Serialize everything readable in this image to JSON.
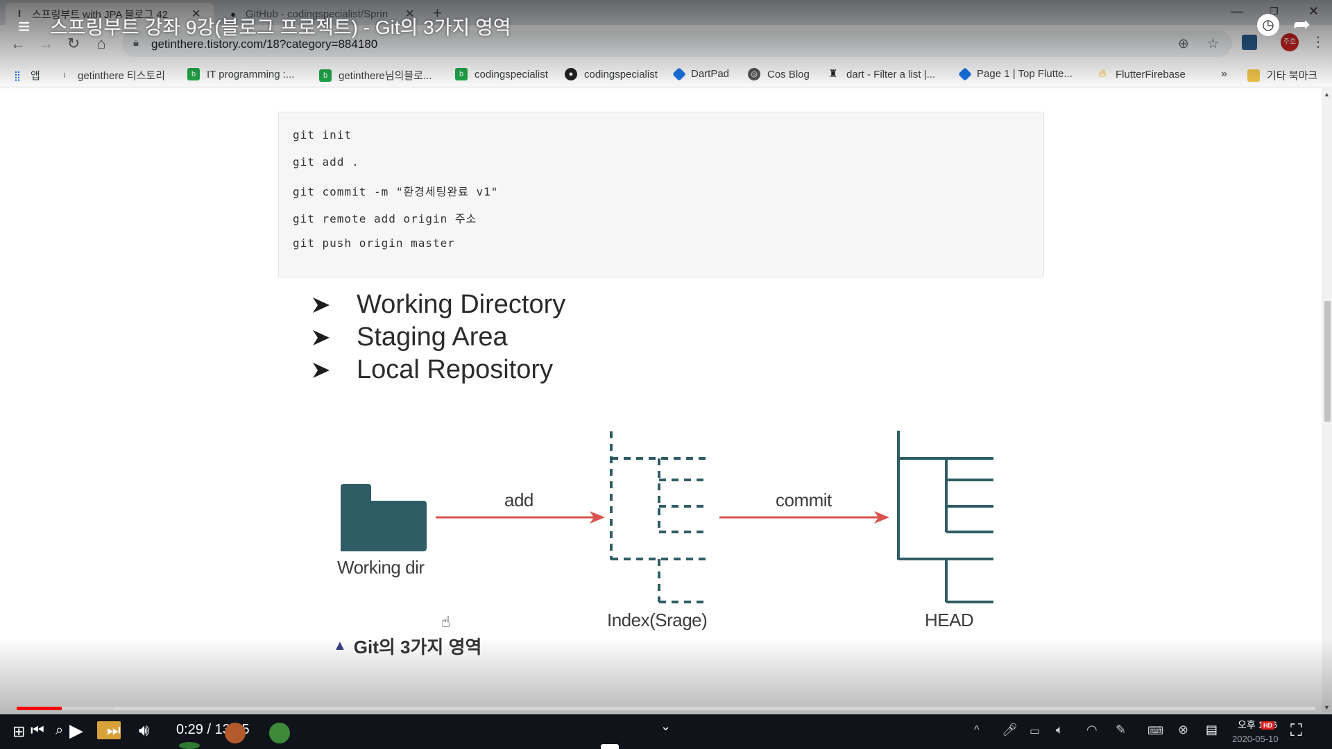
{
  "browser": {
    "tabs": [
      {
        "title": "스프링부트 with JPA 블로그 42",
        "favicon": "tistory-icon",
        "active": true
      },
      {
        "title": "GitHub - codingspecialist/Sprin",
        "favicon": "github-icon",
        "active": false
      }
    ],
    "url": "getinthere.tistory.com/18?category=884180",
    "profile_label": "주호"
  },
  "bookmarks": {
    "apps_label": "앱",
    "items": [
      {
        "label": "getinthere 티스토리",
        "icon": "tistory-icon",
        "color": "#222222"
      },
      {
        "label": "IT programming :...",
        "icon": "blog-icon",
        "color": "#21a84a"
      },
      {
        "label": "getinthere님의블로...",
        "icon": "blog-icon",
        "color": "#21a84a"
      },
      {
        "label": "codingspecialist",
        "icon": "blog-icon",
        "color": "#21a84a"
      },
      {
        "label": "codingspecialist",
        "icon": "github-icon",
        "color": "#222222"
      },
      {
        "label": "DartPad",
        "icon": "dart-icon",
        "color": "#1a73e8"
      },
      {
        "label": "Cos Blog",
        "icon": "globe-icon",
        "color": "#555555"
      },
      {
        "label": "dart - Filter a list |...",
        "icon": "stackoverflow-icon",
        "color": "#222222"
      },
      {
        "label": "Page 1 | Top Flutte...",
        "icon": "flutter-icon",
        "color": "#1a73e8"
      },
      {
        "label": "FlutterFirebase",
        "icon": "firebase-icon",
        "color": "#f5b400"
      }
    ],
    "overflow": "»",
    "other_folder": "기타 북마크"
  },
  "video": {
    "title": "스프링부트 강좌 9강(블로그 프로젝트) - Git의 3가지 영역",
    "current_time": "0:29",
    "duration": "13:55",
    "time_display": "0:29 / 13:55",
    "played_fraction": 0.0347,
    "buffered_fraction": 0.0755
  },
  "code_lines": [
    "git init",
    "git add .",
    "git commit -m \"환경세팅완료 v1\"",
    "git remote add origin 주소",
    "git push origin master"
  ],
  "bullets": [
    "Working Directory",
    "Staging Area",
    "Local Repository"
  ],
  "diagram": {
    "working_dir_label": "Working dir",
    "add_label": "add",
    "index_label": "Index(Srage)",
    "commit_label": "commit",
    "head_label": "HEAD",
    "caption_marker": "▲",
    "caption": "Git의 3가지 영역",
    "colors": {
      "teal": "#2f5d66",
      "arrow": "#d9534f"
    }
  },
  "system": {
    "clock_time": "오후 1:56",
    "clock_date": "2020-05-10",
    "hd_label": "HD"
  }
}
